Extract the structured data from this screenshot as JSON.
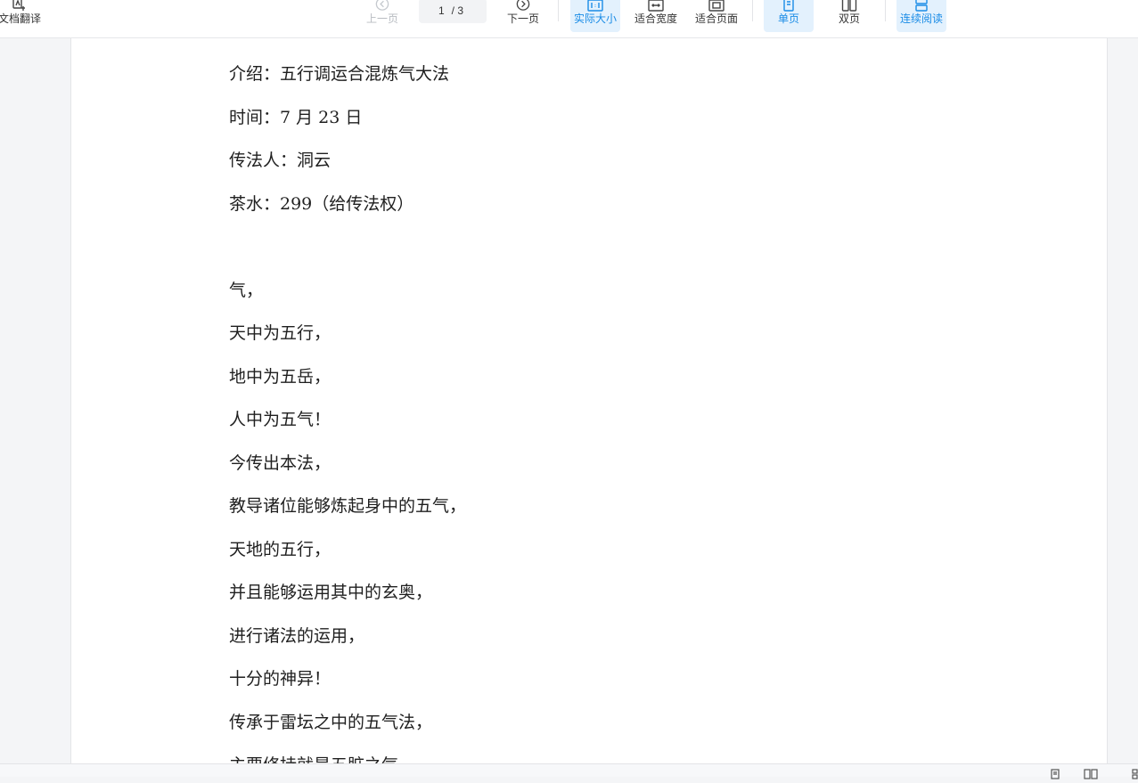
{
  "toolbar": {
    "translate_label": "文档翻译",
    "prev_label": "上一页",
    "page_current": "1",
    "page_total": "/ 3",
    "next_label": "下一页",
    "actual_size_label": "实际大小",
    "fit_width_label": "适合宽度",
    "fit_page_label": "适合页面",
    "single_page_label": "单页",
    "double_page_label": "双页",
    "continuous_label": "连续阅读"
  },
  "document": {
    "lines": [
      "介绍：五行调运合混炼气大法",
      "时间：7 月 23 日",
      "传法人：洞云",
      "茶水：299（给传法权）",
      "",
      "气，",
      "天中为五行，",
      "地中为五岳，",
      "人中为五气！",
      "今传出本法，",
      "教导诸位能够炼起身中的五气，",
      "天地的五行，",
      "并且能够运用其中的玄奥，",
      "进行诸法的运用，",
      "十分的神异！",
      "传承于雷坛之中的五气法，",
      "主要修持就是五脏之气，"
    ]
  },
  "colors": {
    "accent": "#1a8ce6",
    "active_bg": "#e3f1fd"
  }
}
